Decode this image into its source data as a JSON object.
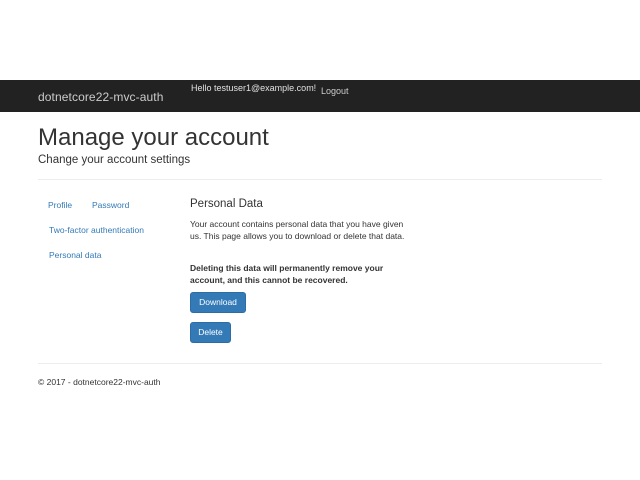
{
  "navbar": {
    "brand": "dotnetcore22-mvc-auth",
    "greeting": "Hello testuser1@example.com!",
    "logout": "Logout"
  },
  "header": {
    "title": "Manage your account",
    "subtitle": "Change your account settings"
  },
  "sidebar": {
    "items": [
      {
        "label": "Profile"
      },
      {
        "label": "Password"
      },
      {
        "label": "Two-factor authentication"
      },
      {
        "label": "Personal data"
      }
    ]
  },
  "main": {
    "section_title": "Personal Data",
    "description": "Your account contains personal data that you have given us. This page allows you to download or delete that data.",
    "warning": "Deleting this data will permanently remove your account, and this cannot be recovered.",
    "download_label": "Download",
    "delete_label": "Delete"
  },
  "footer": {
    "text": "© 2017 - dotnetcore22-mvc-auth"
  },
  "colors": {
    "navbar_bg": "#222222",
    "link": "#337ab7",
    "button_primary": "#337ab7"
  }
}
